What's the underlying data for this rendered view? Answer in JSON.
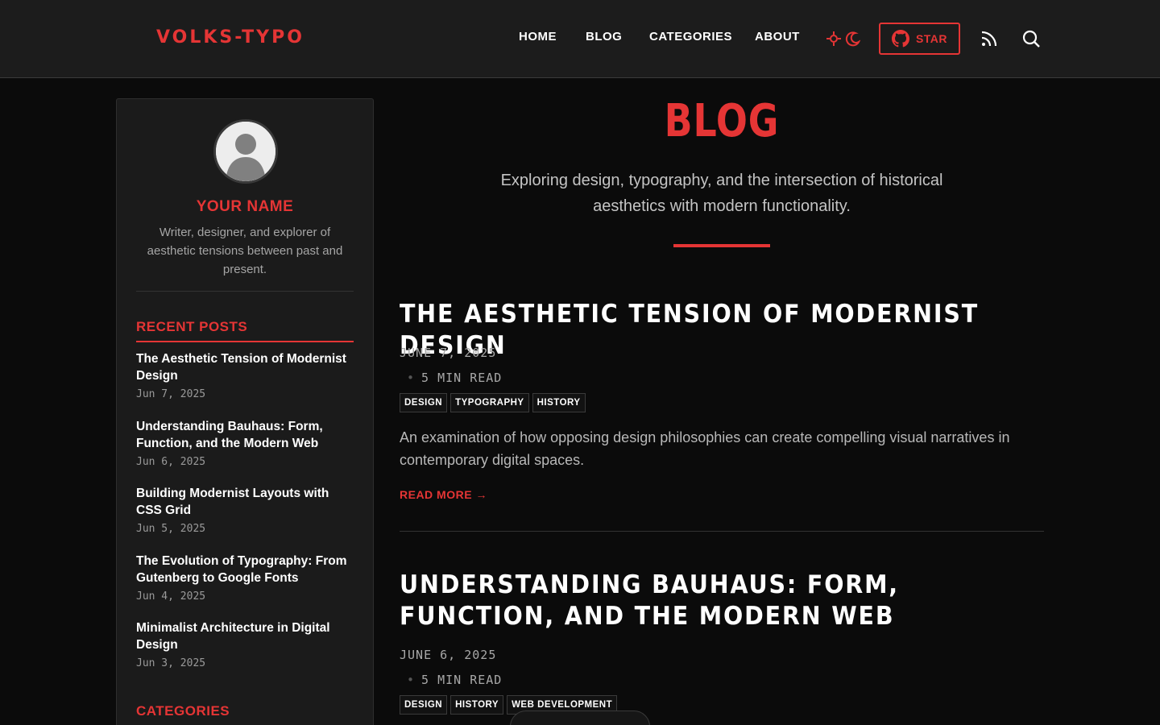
{
  "header": {
    "logo": "VOLKS-TYPO",
    "nav": [
      "HOME",
      "BLOG",
      "CATEGORIES",
      "ABOUT"
    ],
    "star_label": "STAR",
    "icons": [
      "sun-icon",
      "moon-icon",
      "github-icon",
      "rss-icon",
      "search-icon"
    ]
  },
  "sidebar": {
    "profile_name": "YOUR NAME",
    "profile_bio": "Writer, designer, and explorer of aesthetic tensions between past and present.",
    "recent_heading": "RECENT POSTS",
    "recent_posts": [
      {
        "title": "The Aesthetic Tension of Modernist Design",
        "date": "Jun 7, 2025"
      },
      {
        "title": "Understanding Bauhaus: Form, Function, and the Modern Web",
        "date": "Jun 6, 2025"
      },
      {
        "title": "Building Modernist Layouts with CSS Grid",
        "date": "Jun 5, 2025"
      },
      {
        "title": "The Evolution of Typography: From Gutenberg to Google Fonts",
        "date": "Jun 4, 2025"
      },
      {
        "title": "Minimalist Architecture in Digital Design",
        "date": "Jun 3, 2025"
      }
    ],
    "categories_heading": "CATEGORIES"
  },
  "main": {
    "title": "BLOG",
    "description": "Exploring design, typography, and the intersection of historical aesthetics with modern functionality.",
    "posts": [
      {
        "title": "THE AESTHETIC TENSION OF MODERNIST DESIGN",
        "date": "JUNE 7, 2025",
        "read_time": "5 MIN READ",
        "tags": [
          "DESIGN",
          "TYPOGRAPHY",
          "HISTORY"
        ],
        "excerpt": "An examination of how opposing design philosophies can create compelling visual narratives in contemporary digital spaces.",
        "read_more": "READ MORE →"
      },
      {
        "title": "UNDERSTANDING BAUHAUS: FORM, FUNCTION, AND THE MODERN WEB",
        "date": "JUNE 6, 2025",
        "read_time": "5 MIN READ",
        "tags": [
          "DESIGN",
          "HISTORY",
          "WEB DEVELOPMENT"
        ]
      }
    ]
  },
  "colors": {
    "accent": "#e53535",
    "background": "#0b0b0b",
    "header": "#1c1c1c",
    "sidebar": "#1b1b1b"
  }
}
